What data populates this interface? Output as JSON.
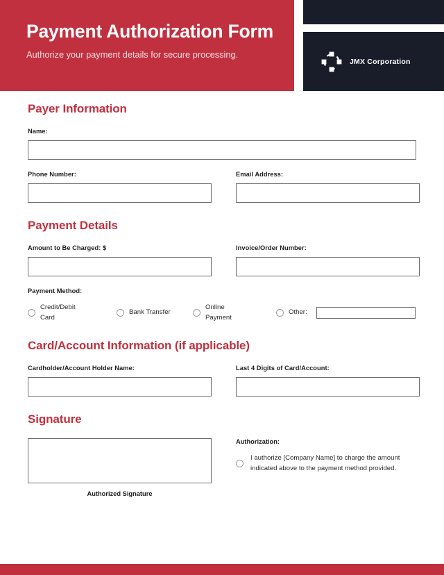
{
  "header": {
    "title": "Payment Authorization Form",
    "subtitle": "Authorize your payment details for secure processing.",
    "brand_name": "JMX Corporation",
    "brand_logo_icon": "dashed-circle-squares-icon",
    "accent_color": "#C1303F",
    "brand_dark_color": "#191D29"
  },
  "sections": {
    "payer": {
      "title": "Payer Information",
      "name_label": "Name:",
      "name_value": "",
      "phone_label": "Phone Number:",
      "phone_value": "",
      "email_label": "Email Address:",
      "email_value": ""
    },
    "payment": {
      "title": "Payment Details",
      "amount_label": "Amount to Be Charged: $",
      "amount_value": "",
      "invoice_label": "Invoice/Order Number:",
      "invoice_value": "",
      "method_label": "Payment Method:",
      "methods": [
        {
          "label": "Credit/Debit Card",
          "selected": false
        },
        {
          "label": "Bank Transfer",
          "selected": false
        },
        {
          "label": "Online Payment",
          "selected": false
        },
        {
          "label": "Other:",
          "selected": false
        }
      ],
      "other_value": ""
    },
    "card": {
      "title": "Card/Account Information (if applicable)",
      "holder_label": "Cardholder/Account Holder Name:",
      "holder_value": "",
      "last4_label": "Last 4 Digits of Card/Account:",
      "last4_value": ""
    },
    "signature": {
      "title": "Signature",
      "signature_value": "",
      "caption": "Authorized Signature",
      "authorization_label": "Authorization:",
      "authorization_text": "I authorize [Company Name] to charge the amount indicated above to the payment method provided.",
      "authorization_checked": false
    }
  }
}
